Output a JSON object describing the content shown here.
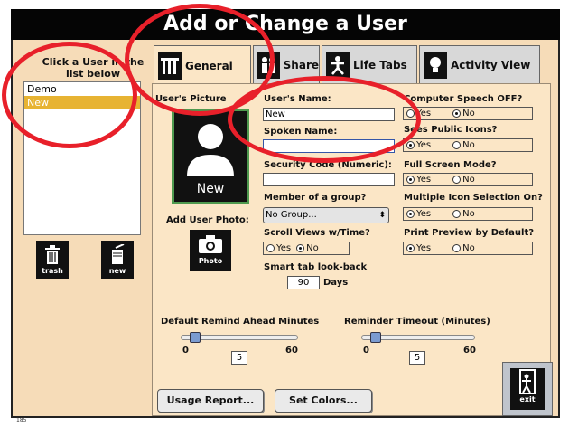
{
  "window": {
    "title": "Add or Change a User"
  },
  "sidebar": {
    "instruction": "Click a User in the list below",
    "users": [
      {
        "name": "Demo",
        "selected": false
      },
      {
        "name": "New",
        "selected": true
      }
    ],
    "trash_label": "trash",
    "new_label": "new"
  },
  "tabs": [
    {
      "label": "General",
      "icon": "tools-icon",
      "active": true
    },
    {
      "label": "Share",
      "icon": "people-icon",
      "active": false
    },
    {
      "label": "Life Tabs",
      "icon": "figure-icon",
      "active": false
    },
    {
      "label": "Activity View",
      "icon": "lightbulb-icon",
      "active": false
    }
  ],
  "general": {
    "picture_label": "User's Picture",
    "picture_caption": "New",
    "add_photo_label": "Add User Photo:",
    "photo_button_label": "Photo",
    "users_name_label": "User's Name:",
    "users_name_value": "New",
    "spoken_name_label": "Spoken Name:",
    "spoken_name_value": "",
    "security_code_label": "Security Code (Numeric):",
    "security_code_value": "",
    "group_label": "Member of a group?",
    "group_value": "No Group...",
    "scroll_label": "Scroll Views w/Time?",
    "scroll_yes": "Yes",
    "scroll_no": "No",
    "smart_tab_label": "Smart tab look-back",
    "smart_tab_value": "90",
    "smart_tab_unit": "Days",
    "options": [
      {
        "label": "Computer Speech OFF?",
        "yes": "Yes",
        "no": "No",
        "selected": "no"
      },
      {
        "label": "Sees Public Icons?",
        "yes": "Yes",
        "no": "No",
        "selected": "yes"
      },
      {
        "label": "Full Screen Mode?",
        "yes": "Yes",
        "no": "No",
        "selected": "yes"
      },
      {
        "label": "Multiple Icon Selection On?",
        "yes": "Yes",
        "no": "No",
        "selected": "yes"
      },
      {
        "label": "Print Preview by Default?",
        "yes": "Yes",
        "no": "No",
        "selected": "yes"
      }
    ],
    "remind_ahead": {
      "label": "Default Remind Ahead Minutes",
      "min": "0",
      "max": "60",
      "value": "5"
    },
    "reminder_timeout": {
      "label": "Reminder Timeout (Minutes)",
      "min": "0",
      "max": "60",
      "value": "5"
    },
    "usage_report_label": "Usage Report...",
    "set_colors_label": "Set Colors...",
    "exit_label": "exit"
  },
  "footer": {
    "id": "185"
  },
  "colors": {
    "annotation": "#e8202a",
    "selection": "#e7b332",
    "panel": "#fbe6c6",
    "frame": "#f6dcb8"
  }
}
